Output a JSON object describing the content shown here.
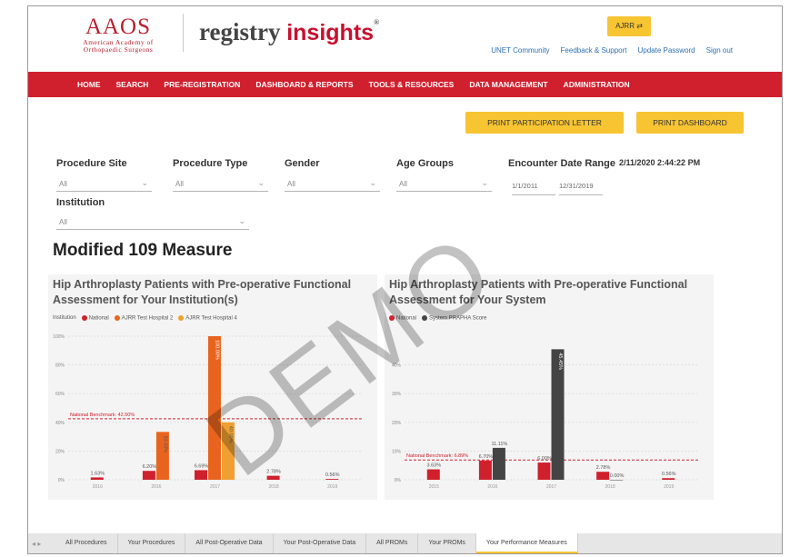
{
  "header": {
    "aaos_logo": {
      "abbr": "AAOS",
      "line1": "American Academy of",
      "line2": "Orthopaedic Surgeons"
    },
    "registry_logo": {
      "word1": "registry",
      "word2": "insights",
      "mark": "®"
    },
    "account_button": "AJRR ⇄",
    "links": [
      "UNET Community",
      "Feedback & Support",
      "Update Password",
      "Sign out"
    ]
  },
  "nav": {
    "items": [
      "HOME",
      "SEARCH",
      "PRE-REGISTRATION",
      "DASHBOARD & REPORTS",
      "TOOLS & RESOURCES",
      "DATA MANAGEMENT",
      "ADMINISTRATION"
    ],
    "color": "#d0202e"
  },
  "actions": {
    "print_letter": "PRINT PARTICIPATION LETTER",
    "print_dashboard": "PRINT DASHBOARD",
    "color": "#f7c432"
  },
  "filters": {
    "procedure_site": {
      "label": "Procedure Site",
      "value": "All"
    },
    "procedure_type": {
      "label": "Procedure Type",
      "value": "All"
    },
    "gender": {
      "label": "Gender",
      "value": "All"
    },
    "age_groups": {
      "label": "Age Groups",
      "value": "All"
    },
    "date_range": {
      "label": "Encounter Date Range",
      "start": "1/1/2011",
      "end": "12/31/2019"
    },
    "institution": {
      "label": "Institution",
      "value": "All"
    },
    "timestamp": "2/11/2020 2:44:22 PM"
  },
  "section_title": "Modified 109 Measure",
  "chart_data": [
    {
      "type": "bar",
      "title": "Hip Arthroplasty Patients with Pre-operative Functional Assessment for Your Institution(s)",
      "legend_title": "Institution",
      "categories": [
        "2016",
        "2016",
        "2017",
        "2018",
        "2019"
      ],
      "ylim": [
        0,
        100
      ],
      "yticks": [
        "0%",
        "20%",
        "40%",
        "60%",
        "80%",
        "100%"
      ],
      "series": [
        {
          "name": "National",
          "color": "#d0202e",
          "values": [
            1.63,
            6.2,
            6.69,
            2.78,
            0.56
          ],
          "labels": [
            "1.63%",
            "6.20%",
            "6.69%",
            "2.78%",
            "0.56%"
          ]
        },
        {
          "name": "AJRR Test Hospital 2",
          "color": "#e8641e",
          "values": [
            null,
            33.33,
            100.0,
            null,
            null
          ],
          "labels": [
            "",
            "33.33%",
            "100.00%",
            "",
            ""
          ]
        },
        {
          "name": "AJRR Test Hospital 4",
          "color": "#f0a030",
          "values": [
            null,
            null,
            40.0,
            null,
            null
          ],
          "labels": [
            "",
            "",
            "40.00%",
            "",
            ""
          ]
        }
      ],
      "benchmark": {
        "label": "National Benchmark: 42.50%",
        "value": 42.5
      },
      "grid": true,
      "legend_position": "top-left"
    },
    {
      "type": "bar",
      "title": "Hip Arthroplasty Patients with Pre-operative Functional Assessment for Your System",
      "legend_title": "",
      "categories": [
        "2015",
        "2016",
        "2017",
        "2018",
        "2019"
      ],
      "ylim": [
        0,
        50
      ],
      "yticks": [
        "0%",
        "10%",
        "20%",
        "30%",
        "40%"
      ],
      "series": [
        {
          "name": "National",
          "color": "#d0202e",
          "values": [
            3.63,
            6.7,
            6.0,
            2.78,
            0.56
          ],
          "labels": [
            "3.63%",
            "6.70%",
            "6.00%",
            "2.78%",
            "0.56%"
          ]
        },
        {
          "name": "System PRAPHA Score",
          "color": "#444444",
          "values": [
            null,
            11.11,
            45.45,
            0.0,
            null
          ],
          "labels": [
            "",
            "11.11%",
            "45.45%",
            "0.00%",
            ""
          ]
        }
      ],
      "benchmark": {
        "label": "National Benchmark: 6.89%",
        "value": 6.89
      },
      "grid": true,
      "legend_position": "top-left"
    }
  ],
  "tabs": {
    "items": [
      "All Procedures",
      "Your Procedures",
      "All Post-Operative Data",
      "Your Post-Operative Data",
      "All PROMs",
      "Your PROMs",
      "Your Performance Measures"
    ],
    "active": "Your Performance Measures"
  },
  "watermark": "DEMO"
}
